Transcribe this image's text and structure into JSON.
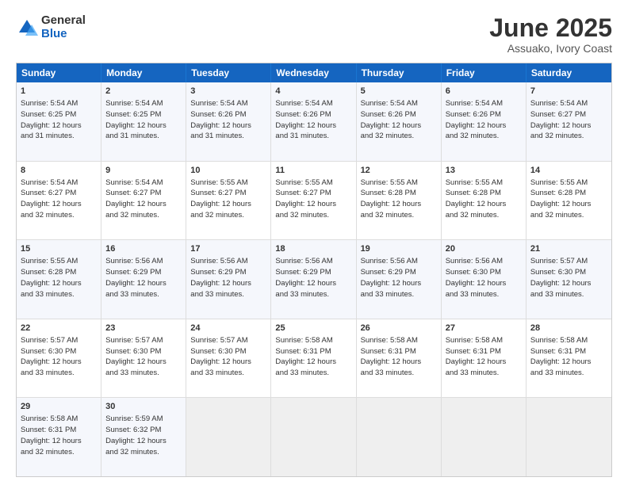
{
  "logo": {
    "general": "General",
    "blue": "Blue"
  },
  "title": "June 2025",
  "subtitle": "Assuako, Ivory Coast",
  "header": {
    "days": [
      "Sunday",
      "Monday",
      "Tuesday",
      "Wednesday",
      "Thursday",
      "Friday",
      "Saturday"
    ]
  },
  "rows": [
    [
      {
        "day": "1",
        "sunrise": "5:54 AM",
        "sunset": "6:25 PM",
        "daylight": "12 hours and 31 minutes."
      },
      {
        "day": "2",
        "sunrise": "5:54 AM",
        "sunset": "6:25 PM",
        "daylight": "12 hours and 31 minutes."
      },
      {
        "day": "3",
        "sunrise": "5:54 AM",
        "sunset": "6:26 PM",
        "daylight": "12 hours and 31 minutes."
      },
      {
        "day": "4",
        "sunrise": "5:54 AM",
        "sunset": "6:26 PM",
        "daylight": "12 hours and 31 minutes."
      },
      {
        "day": "5",
        "sunrise": "5:54 AM",
        "sunset": "6:26 PM",
        "daylight": "12 hours and 32 minutes."
      },
      {
        "day": "6",
        "sunrise": "5:54 AM",
        "sunset": "6:26 PM",
        "daylight": "12 hours and 32 minutes."
      },
      {
        "day": "7",
        "sunrise": "5:54 AM",
        "sunset": "6:27 PM",
        "daylight": "12 hours and 32 minutes."
      }
    ],
    [
      {
        "day": "8",
        "sunrise": "5:54 AM",
        "sunset": "6:27 PM",
        "daylight": "12 hours and 32 minutes."
      },
      {
        "day": "9",
        "sunrise": "5:54 AM",
        "sunset": "6:27 PM",
        "daylight": "12 hours and 32 minutes."
      },
      {
        "day": "10",
        "sunrise": "5:55 AM",
        "sunset": "6:27 PM",
        "daylight": "12 hours and 32 minutes."
      },
      {
        "day": "11",
        "sunrise": "5:55 AM",
        "sunset": "6:27 PM",
        "daylight": "12 hours and 32 minutes."
      },
      {
        "day": "12",
        "sunrise": "5:55 AM",
        "sunset": "6:28 PM",
        "daylight": "12 hours and 32 minutes."
      },
      {
        "day": "13",
        "sunrise": "5:55 AM",
        "sunset": "6:28 PM",
        "daylight": "12 hours and 32 minutes."
      },
      {
        "day": "14",
        "sunrise": "5:55 AM",
        "sunset": "6:28 PM",
        "daylight": "12 hours and 32 minutes."
      }
    ],
    [
      {
        "day": "15",
        "sunrise": "5:55 AM",
        "sunset": "6:28 PM",
        "daylight": "12 hours and 33 minutes."
      },
      {
        "day": "16",
        "sunrise": "5:56 AM",
        "sunset": "6:29 PM",
        "daylight": "12 hours and 33 minutes."
      },
      {
        "day": "17",
        "sunrise": "5:56 AM",
        "sunset": "6:29 PM",
        "daylight": "12 hours and 33 minutes."
      },
      {
        "day": "18",
        "sunrise": "5:56 AM",
        "sunset": "6:29 PM",
        "daylight": "12 hours and 33 minutes."
      },
      {
        "day": "19",
        "sunrise": "5:56 AM",
        "sunset": "6:29 PM",
        "daylight": "12 hours and 33 minutes."
      },
      {
        "day": "20",
        "sunrise": "5:56 AM",
        "sunset": "6:30 PM",
        "daylight": "12 hours and 33 minutes."
      },
      {
        "day": "21",
        "sunrise": "5:57 AM",
        "sunset": "6:30 PM",
        "daylight": "12 hours and 33 minutes."
      }
    ],
    [
      {
        "day": "22",
        "sunrise": "5:57 AM",
        "sunset": "6:30 PM",
        "daylight": "12 hours and 33 minutes."
      },
      {
        "day": "23",
        "sunrise": "5:57 AM",
        "sunset": "6:30 PM",
        "daylight": "12 hours and 33 minutes."
      },
      {
        "day": "24",
        "sunrise": "5:57 AM",
        "sunset": "6:30 PM",
        "daylight": "12 hours and 33 minutes."
      },
      {
        "day": "25",
        "sunrise": "5:58 AM",
        "sunset": "6:31 PM",
        "daylight": "12 hours and 33 minutes."
      },
      {
        "day": "26",
        "sunrise": "5:58 AM",
        "sunset": "6:31 PM",
        "daylight": "12 hours and 33 minutes."
      },
      {
        "day": "27",
        "sunrise": "5:58 AM",
        "sunset": "6:31 PM",
        "daylight": "12 hours and 33 minutes."
      },
      {
        "day": "28",
        "sunrise": "5:58 AM",
        "sunset": "6:31 PM",
        "daylight": "12 hours and 33 minutes."
      }
    ],
    [
      {
        "day": "29",
        "sunrise": "5:58 AM",
        "sunset": "6:31 PM",
        "daylight": "12 hours and 32 minutes."
      },
      {
        "day": "30",
        "sunrise": "5:59 AM",
        "sunset": "6:32 PM",
        "daylight": "12 hours and 32 minutes."
      },
      null,
      null,
      null,
      null,
      null
    ]
  ]
}
